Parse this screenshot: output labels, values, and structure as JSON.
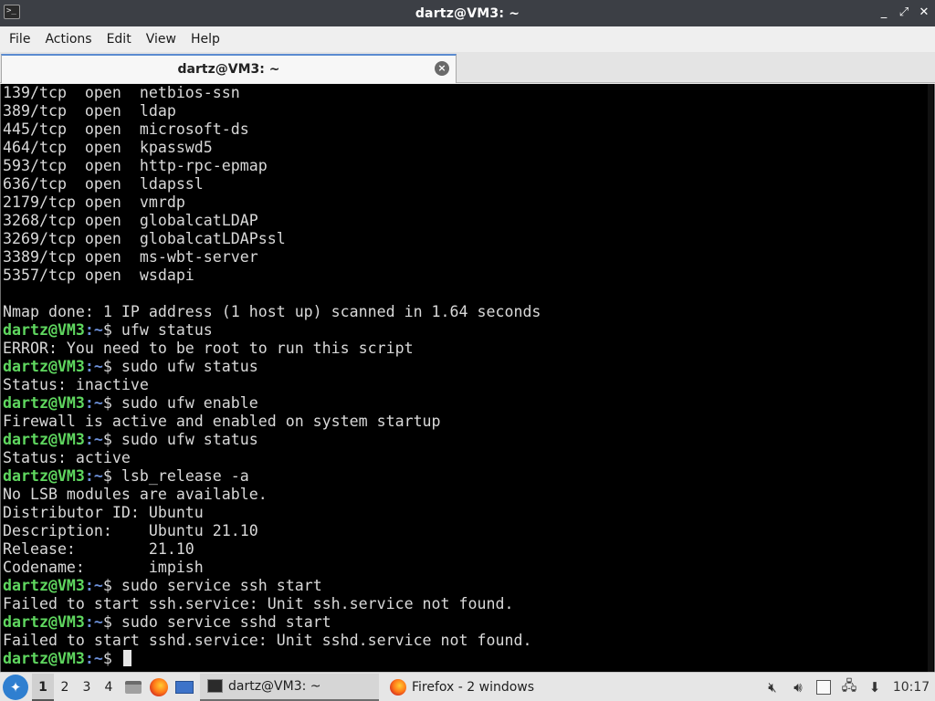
{
  "window": {
    "title": "dartz@VM3: ~",
    "icon": "terminal-icon",
    "controls": {
      "minimize": "_",
      "maximize": "⤢",
      "close": "✕"
    }
  },
  "menu": [
    "File",
    "Actions",
    "Edit",
    "View",
    "Help"
  ],
  "tab": {
    "label": "dartz@VM3: ~",
    "close_icon": "close-circle-icon"
  },
  "prompt": {
    "user_host": "dartz@VM3",
    "path": ":~",
    "symbol": "$"
  },
  "terminal": {
    "lines": [
      {
        "type": "out",
        "text": "139/tcp  open  netbios-ssn"
      },
      {
        "type": "out",
        "text": "389/tcp  open  ldap"
      },
      {
        "type": "out",
        "text": "445/tcp  open  microsoft-ds"
      },
      {
        "type": "out",
        "text": "464/tcp  open  kpasswd5"
      },
      {
        "type": "out",
        "text": "593/tcp  open  http-rpc-epmap"
      },
      {
        "type": "out",
        "text": "636/tcp  open  ldapssl"
      },
      {
        "type": "out",
        "text": "2179/tcp open  vmrdp"
      },
      {
        "type": "out",
        "text": "3268/tcp open  globalcatLDAP"
      },
      {
        "type": "out",
        "text": "3269/tcp open  globalcatLDAPssl"
      },
      {
        "type": "out",
        "text": "3389/tcp open  ms-wbt-server"
      },
      {
        "type": "out",
        "text": "5357/tcp open  wsdapi"
      },
      {
        "type": "out",
        "text": ""
      },
      {
        "type": "out",
        "text": "Nmap done: 1 IP address (1 host up) scanned in 1.64 seconds"
      },
      {
        "type": "cmd",
        "text": " ufw status"
      },
      {
        "type": "out",
        "text": "ERROR: You need to be root to run this script"
      },
      {
        "type": "cmd",
        "text": " sudo ufw status"
      },
      {
        "type": "out",
        "text": "Status: inactive"
      },
      {
        "type": "cmd",
        "text": " sudo ufw enable"
      },
      {
        "type": "out",
        "text": "Firewall is active and enabled on system startup"
      },
      {
        "type": "cmd",
        "text": " sudo ufw status"
      },
      {
        "type": "out",
        "text": "Status: active"
      },
      {
        "type": "cmd",
        "text": " lsb_release -a"
      },
      {
        "type": "out",
        "text": "No LSB modules are available."
      },
      {
        "type": "out",
        "text": "Distributor ID: Ubuntu"
      },
      {
        "type": "out",
        "text": "Description:    Ubuntu 21.10"
      },
      {
        "type": "out",
        "text": "Release:        21.10"
      },
      {
        "type": "out",
        "text": "Codename:       impish"
      },
      {
        "type": "cmd",
        "text": " sudo service ssh start"
      },
      {
        "type": "out",
        "text": "Failed to start ssh.service: Unit ssh.service not found."
      },
      {
        "type": "cmd",
        "text": " sudo service sshd start"
      },
      {
        "type": "out",
        "text": "Failed to start sshd.service: Unit sshd.service not found."
      },
      {
        "type": "cmd",
        "text": " "
      }
    ]
  },
  "taskbar": {
    "workspaces": [
      "1",
      "2",
      "3",
      "4"
    ],
    "active_workspace": "1",
    "quicklaunch": [
      "file-manager-icon",
      "firefox-icon",
      "show-desktop-icon"
    ],
    "tasks": [
      {
        "label": "dartz@VM3: ~",
        "icon": "terminal-icon",
        "active": true
      },
      {
        "label": "Firefox - 2 windows",
        "icon": "firefox-icon",
        "active": false
      }
    ],
    "tray": [
      "mute-indicator-icon",
      "volume-icon",
      "clipboard-icon",
      "network-icon",
      "updates-icon"
    ],
    "clock": "10:17"
  },
  "colors": {
    "terminal_bg": "#000000",
    "terminal_fg": "#d9d9d9",
    "prompt_user": "#5fd75f",
    "prompt_path": "#6b8fd8",
    "titlebar_bg": "#3c3f45"
  }
}
